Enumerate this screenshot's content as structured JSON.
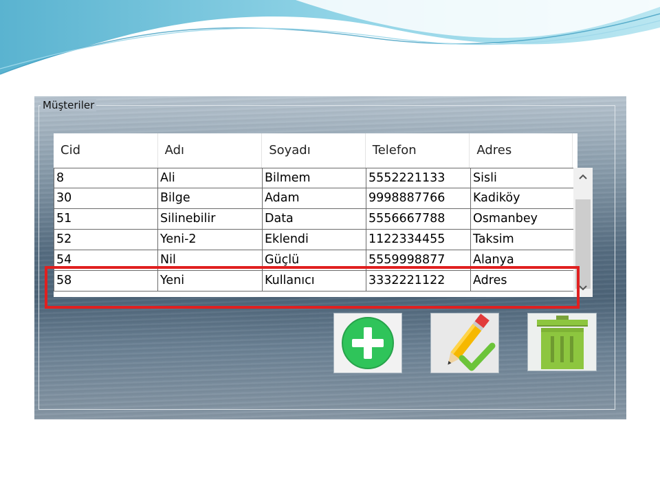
{
  "panel": {
    "title": "Müşteriler"
  },
  "grid": {
    "columns": [
      "Cid",
      "Adı",
      "Soyadı",
      "Telefon",
      "Adres"
    ],
    "rows": [
      [
        "8",
        "Ali",
        "Bilmem",
        "5552221133",
        "Sisli"
      ],
      [
        "30",
        "Bilge",
        "Adam",
        "9998887766",
        "Kadiköy"
      ],
      [
        "51",
        "Silinebilir",
        "Data",
        "5556667788",
        "Osmanbey"
      ],
      [
        "52",
        "Yeni-2",
        "Eklendi",
        "1122334455",
        "Taksim"
      ],
      [
        "54",
        "Nil",
        "Güçlü",
        "5559998877",
        "Alanya"
      ],
      [
        "58",
        "Yeni",
        "Kullanıcı",
        "3332221122",
        "Adres"
      ]
    ],
    "highlighted_row": "58"
  },
  "buttons": {
    "add_icon": "add-icon",
    "edit_icon": "edit-pencil-icon",
    "delete_icon": "trash-icon"
  },
  "colors": {
    "highlight": "#e02020",
    "add_green": "#2fc45a",
    "trash_green": "#8dc63f"
  }
}
